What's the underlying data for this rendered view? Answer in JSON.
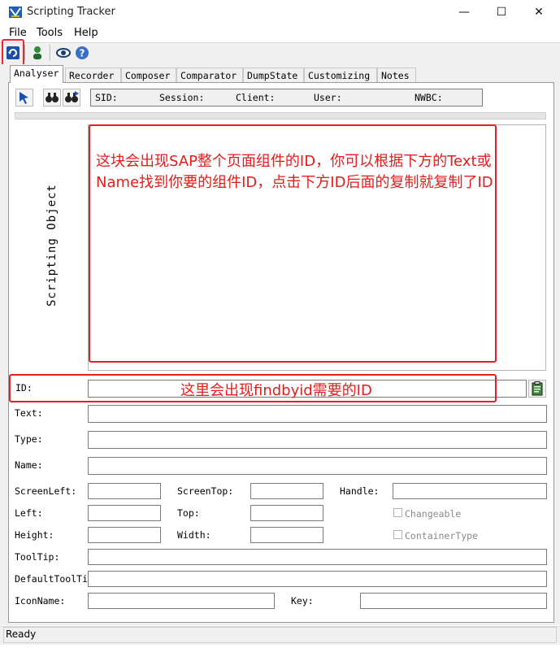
{
  "window": {
    "title": "Scripting Tracker",
    "controls": {
      "minimize": "—",
      "maximize": "☐",
      "close": "✕"
    }
  },
  "menu": {
    "file": "File",
    "tools": "Tools",
    "help": "Help"
  },
  "toolbar": {
    "icons": [
      "refresh-icon",
      "person-icon",
      "eye-icon",
      "help-icon"
    ]
  },
  "tabs": [
    "Analyser",
    "Recorder",
    "Composer",
    "Comparator",
    "DumpState",
    "Customizing",
    "Notes"
  ],
  "info_bar": {
    "sid": "SID:",
    "session": "Session:",
    "client": "Client:",
    "user": "User:",
    "nwbc": "NWBC:"
  },
  "tree": {
    "vertical_label": "Scripting Object"
  },
  "fields": {
    "id": "ID:",
    "text": "Text:",
    "type": "Type:",
    "name": "Name:",
    "screen_left": "ScreenLeft:",
    "screen_top": "ScreenTop:",
    "handle": "Handle:",
    "left": "Left:",
    "top": "Top:",
    "changeable": "Changeable",
    "height": "Height:",
    "width": "Width:",
    "container_type": "ContainerType",
    "tooltip": "ToolTip:",
    "default_tooltip": "DefaultToolTi",
    "icon_name": "IconName:",
    "key": "Key:"
  },
  "annotations": {
    "tree_note": "这块会出现SAP整个页面组件的ID，你可以根据下方的Text或Name找到你要的组件ID，点击下方ID后面的复制就复制了ID",
    "id_note": "这里会出现findbyid需要的ID"
  },
  "status": {
    "text": "Ready"
  },
  "colors": {
    "annotation": "#e81b1b",
    "panel_bg": "#f0f0f0"
  }
}
